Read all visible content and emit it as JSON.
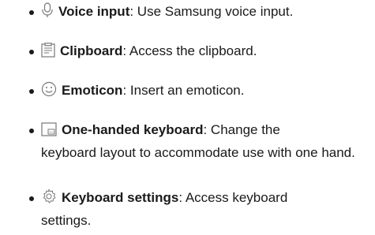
{
  "items": [
    {
      "icon": "microphone-icon",
      "term": "Voice input",
      "description": ": Use Samsung voice input."
    },
    {
      "icon": "clipboard-icon",
      "term": "Clipboard",
      "description": ": Access the clipboard."
    },
    {
      "icon": "emoticon-icon",
      "term": "Emoticon",
      "description": ": Insert an emoticon."
    },
    {
      "icon": "one-handed-keyboard-icon",
      "term": "One-handed keyboard",
      "description": ": Change the",
      "description_cont": "keyboard layout to accommodate use with one hand."
    },
    {
      "icon": "gear-icon",
      "term": "Keyboard settings",
      "description": ": Access keyboard",
      "description_cont": "settings."
    }
  ]
}
